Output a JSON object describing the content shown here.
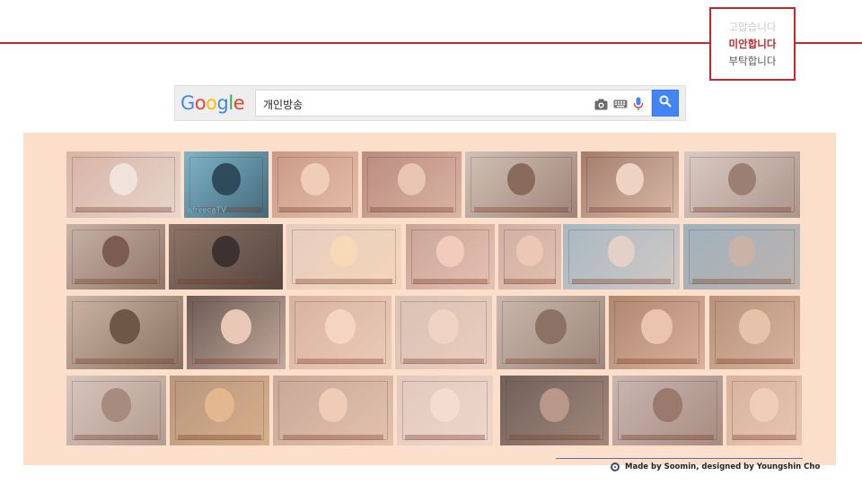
{
  "phrases": {
    "top": "고맙습니다",
    "active": "미안합니다",
    "bottom": "부탁합니다"
  },
  "search": {
    "logo_letters": [
      "G",
      "o",
      "o",
      "g",
      "l",
      "e"
    ],
    "query": "개인방송",
    "icons": [
      "camera-icon",
      "keyboard-icon",
      "microphone-icon",
      "search-icon"
    ]
  },
  "image_results": {
    "rows": [
      [
        {
          "name": "thumb-blurred-stream",
          "bg": "#d7b4a6",
          "accent": "#efe3dc"
        },
        {
          "name": "thumb-afreecatv",
          "bg": "#7fb4c9",
          "accent": "#2d4b5a",
          "caption": "afreecaTV"
        },
        {
          "name": "thumb-streamer-1",
          "bg": "#c99a86",
          "accent": "#f0cdb9"
        },
        {
          "name": "thumb-streamer-2",
          "bg": "#b98c7f",
          "accent": "#e8c4b3"
        },
        {
          "name": "thumb-news-1",
          "bg": "#d2c2b8",
          "accent": "#8a6b5b"
        },
        {
          "name": "thumb-streamer-3",
          "bg": "#a47c6c",
          "accent": "#efd3c2"
        },
        {
          "name": "thumb-chat-overlay",
          "bg": "#d9cbc4",
          "accent": "#9b7f72"
        }
      ],
      [
        {
          "name": "thumb-multi-screen",
          "bg": "#c7b3a6",
          "accent": "#7a5d50"
        },
        {
          "name": "thumb-desk-setup",
          "bg": "#8e7466",
          "accent": "#3e3230"
        },
        {
          "name": "thumb-streamer-4",
          "bg": "#e7cdbf",
          "accent": "#f7d9b8"
        },
        {
          "name": "thumb-streamer-5",
          "bg": "#c9a597",
          "accent": "#f2cbbc"
        },
        {
          "name": "thumb-streamer-6",
          "bg": "#cfb0a2",
          "accent": "#ecc7b6"
        },
        {
          "name": "thumb-news-2",
          "bg": "#a7b8c2",
          "accent": "#e3d0c6"
        },
        {
          "name": "thumb-news-3",
          "bg": "#9fb2bd",
          "accent": "#c9b3a8"
        }
      ],
      [
        {
          "name": "thumb-kitchen",
          "bg": "#cbb5a3",
          "accent": "#6f5748"
        },
        {
          "name": "thumb-player",
          "bg": "#6b5a55",
          "accent": "#e8c9b7"
        },
        {
          "name": "thumb-streamer-7",
          "bg": "#d8b2a0",
          "accent": "#f4d5c2"
        },
        {
          "name": "thumb-streamer-8",
          "bg": "#d9c1b3",
          "accent": "#f1d3c3"
        },
        {
          "name": "thumb-room",
          "bg": "#c9b8ad",
          "accent": "#8c7265"
        },
        {
          "name": "thumb-streamer-9",
          "bg": "#b0866f",
          "accent": "#ebc4ae"
        },
        {
          "name": "thumb-two-people",
          "bg": "#b8927a",
          "accent": "#e6c2a9"
        }
      ],
      [
        {
          "name": "thumb-bedroom",
          "bg": "#d6c6bd",
          "accent": "#a68b7e"
        },
        {
          "name": "thumb-eating",
          "bg": "#b8977e",
          "accent": "#e3b890"
        },
        {
          "name": "thumb-streamer-10",
          "bg": "#c7a898",
          "accent": "#f0cbb6"
        },
        {
          "name": "thumb-streamer-11",
          "bg": "#e2c9bf",
          "accent": "#f5dcd1"
        },
        {
          "name": "thumb-video-editor",
          "bg": "#6f605a",
          "accent": "#b89888"
        },
        {
          "name": "thumb-phone-stream",
          "bg": "#c9b7b2",
          "accent": "#9a7a6c"
        },
        {
          "name": "thumb-streamer-12",
          "bg": "#d6b29f",
          "accent": "#efcdb9"
        }
      ]
    ]
  },
  "credit": {
    "text": "Made by Soomin, designed by Youngshin Cho"
  }
}
